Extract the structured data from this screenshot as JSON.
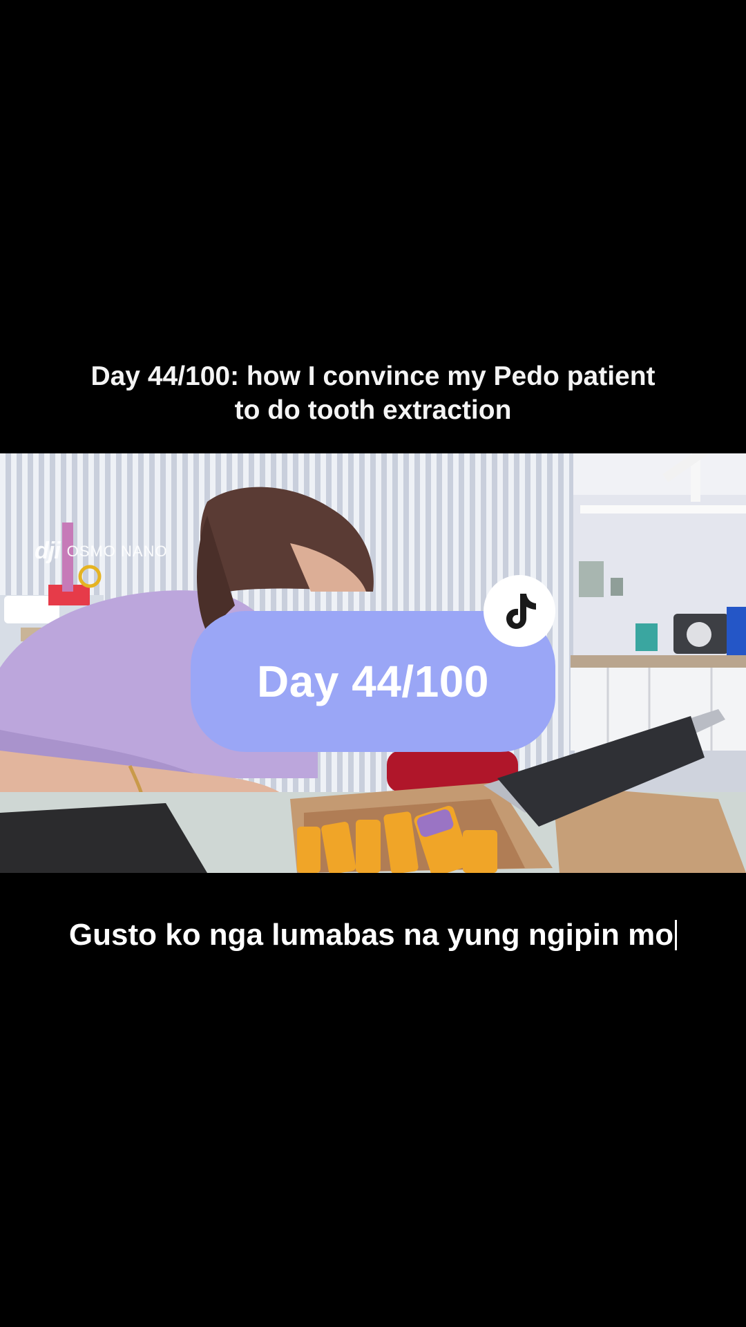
{
  "header": {
    "title_line1": "Day 44/100: how I convince my Pedo patient",
    "title_line2": "to do tooth extraction"
  },
  "video": {
    "watermark_brand": "dji",
    "watermark_model": "OSMO NANO",
    "badge_text": "Day 44/100",
    "badge_color": "#9aa6f6",
    "logo_icon": "tiktok-icon"
  },
  "caption": {
    "text": "Gusto ko nga lumabas na yung ngipin mo"
  }
}
